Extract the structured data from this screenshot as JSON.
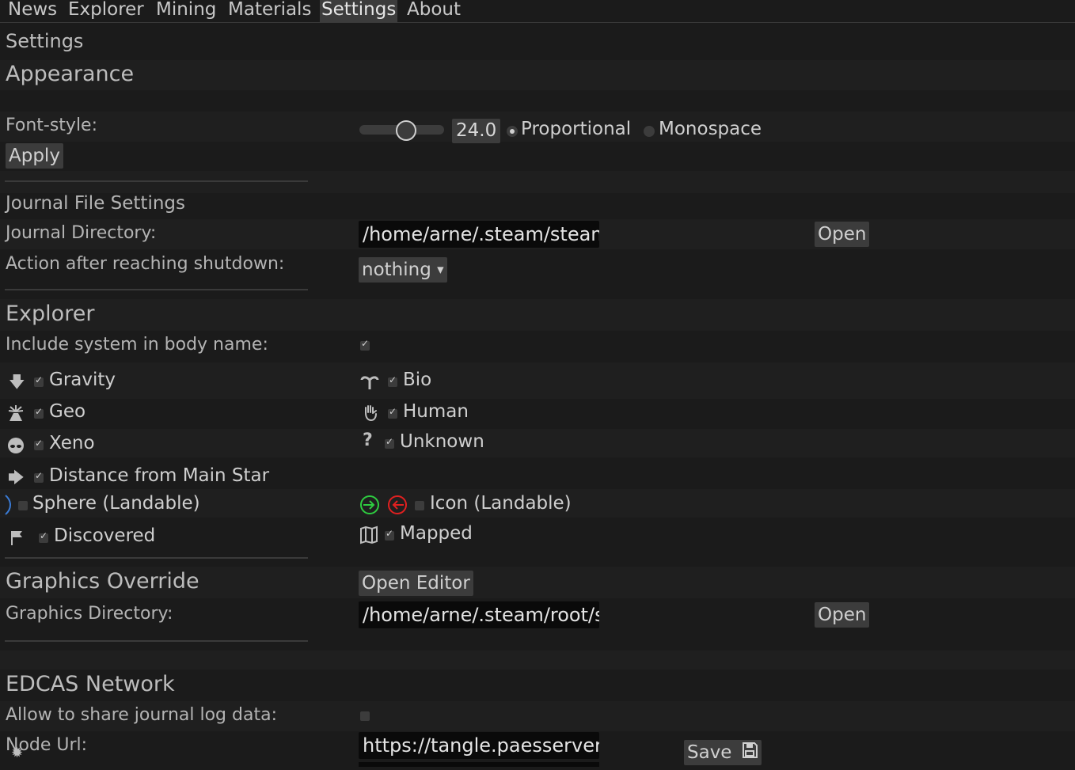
{
  "tabs": [
    "News",
    "Explorer",
    "Mining",
    "Materials",
    "Settings",
    "About"
  ],
  "active_tab": "Settings",
  "page_title": "Settings",
  "appearance": {
    "heading": "Appearance",
    "font_style_label": "Font-style:",
    "font_size_value": "24.0",
    "font_size_fraction": 0.55,
    "font_options": [
      "Proportional",
      "Monospace"
    ],
    "selected_font": "Proportional",
    "apply_label": "Apply"
  },
  "journal": {
    "heading": "Journal File Settings",
    "directory_label": "Journal Directory:",
    "directory_value": "/home/arne/.steam/steam",
    "open_label": "Open",
    "shutdown_label": "Action after reaching shutdown:",
    "shutdown_value": "nothing"
  },
  "explorer": {
    "heading": "Explorer",
    "include_system_label": "Include system in body name:",
    "include_system_checked": true,
    "items": {
      "gravity": {
        "label": "Gravity",
        "checked": true,
        "icon": "down-arrow-icon"
      },
      "bio": {
        "label": "Bio",
        "checked": true,
        "icon": "plant-icon"
      },
      "geo": {
        "label": "Geo",
        "checked": true,
        "icon": "volcano-icon"
      },
      "human": {
        "label": "Human",
        "checked": true,
        "icon": "hand-icon"
      },
      "xeno": {
        "label": "Xeno",
        "checked": true,
        "icon": "alien-icon"
      },
      "unknown": {
        "label": "Unknown",
        "checked": true,
        "icon": "question-icon"
      },
      "distance": {
        "label": "Distance from Main Star",
        "checked": true,
        "icon": "right-arrow-icon"
      },
      "sphere": {
        "label": "Sphere (Landable)",
        "checked": false,
        "icon": "crescent-icon"
      },
      "icon_landable": {
        "label": "Icon (Landable)",
        "checked": false,
        "icon": "landing-icon"
      },
      "discovered": {
        "label": "Discovered",
        "checked": true,
        "icon": "flag-icon"
      },
      "mapped": {
        "label": "Mapped",
        "checked": true,
        "icon": "map-icon"
      }
    },
    "colors": {
      "landable_green": "#2ecc40",
      "landable_red": "#e02020",
      "sphere_blue": "#3a7bd5"
    }
  },
  "graphics": {
    "heading": "Graphics Override",
    "open_editor_label": "Open Editor",
    "directory_label": "Graphics Directory:",
    "directory_value": "/home/arne/.steam/root/s",
    "open_label": "Open"
  },
  "edcas": {
    "heading": "EDCAS Network",
    "share_label": "Allow to share journal log data:",
    "share_checked": false,
    "node_url_label": "Node Url:",
    "node_url_value": "https://tangle.paesserver.",
    "save_label": "Save"
  }
}
